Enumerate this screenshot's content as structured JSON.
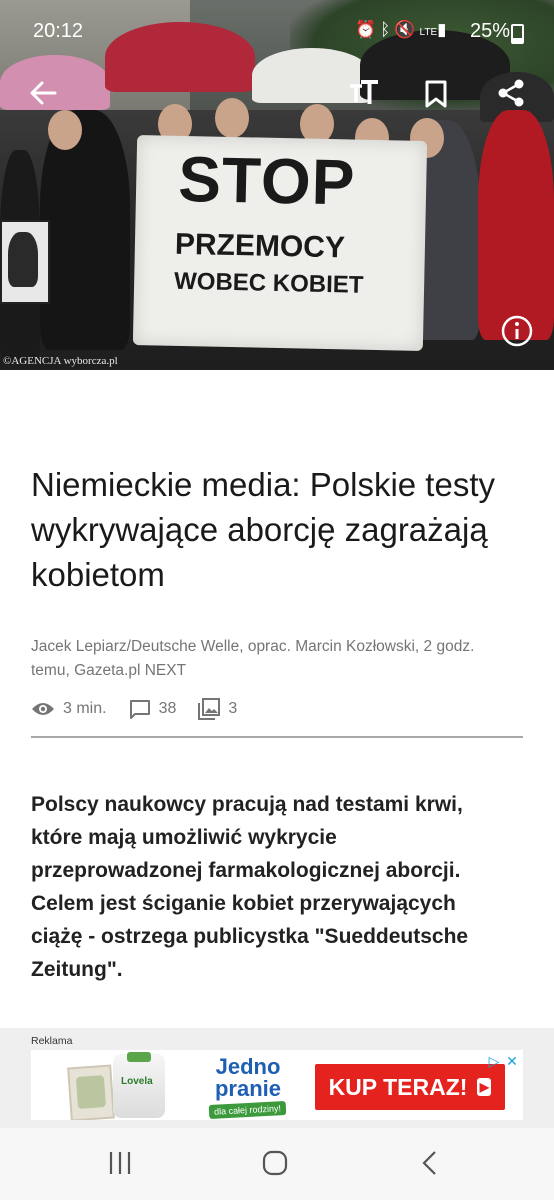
{
  "status_bar": {
    "time": "20:12",
    "battery": "25%",
    "icons": [
      "alarm-icon",
      "bluetooth-icon",
      "mute-icon",
      "lte-icon",
      "signal-icon",
      "battery-icon"
    ]
  },
  "toolbar": {
    "icons": [
      "back-arrow-icon",
      "text-size-icon",
      "bookmark-icon",
      "share-icon"
    ]
  },
  "hero": {
    "banner_line1": "STOP",
    "banner_line2": "PRZEMOCY",
    "banner_line3": "WOBEC KOBIET",
    "credit": "©AGENCJA wyborcza.pl"
  },
  "article": {
    "title": "Niemieckie media: Polskie testy wykrywające aborcję zagrażają kobietom",
    "byline": "Jacek Lepiarz/Deutsche Welle, oprac. Marcin Kozłowski, 2 godz. temu, Gazeta.pl NEXT",
    "read_time": "3 min.",
    "comments": "38",
    "photos": "3",
    "lead": "Polscy naukowcy pracują nad testami krwi, które mają umożliwić wykrycie przeprowadzonej farmakologicznej aborcji. Celem jest ściganie kobiet przerywających ciążę - ostrzega publicystka \"Sueddeutsche Zeitung\"."
  },
  "ad": {
    "label": "Reklama",
    "brand": "Lovela",
    "slogan_main": "Jedno pranie",
    "slogan_sub": "dla całej rodziny!",
    "cta": "KUP TERAZ!",
    "cta_color": "#e4231f"
  },
  "colors": {
    "title_text": "#1a1a1a",
    "meta_text": "#757575",
    "accent_blue": "#1e5fb4"
  }
}
